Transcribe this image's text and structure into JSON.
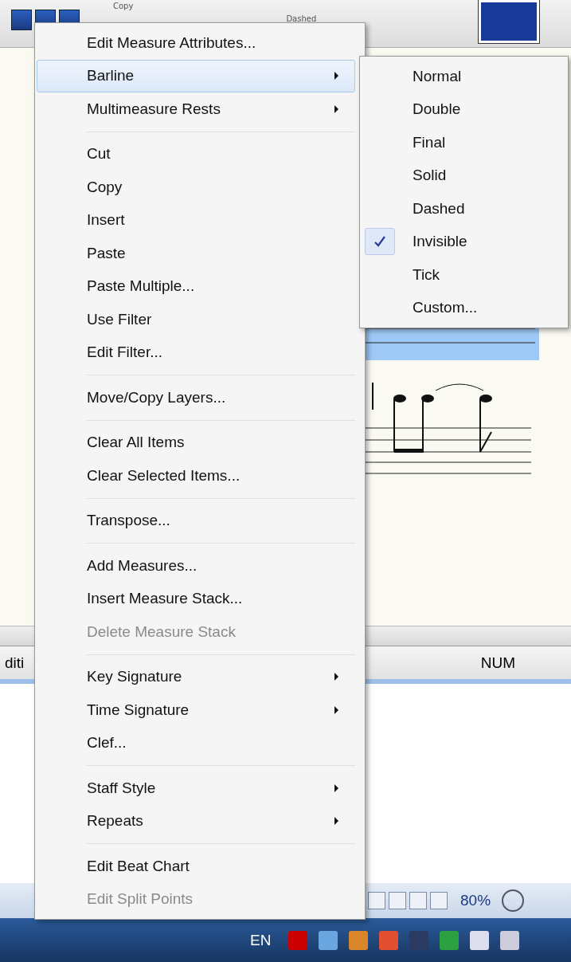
{
  "toolbar": {
    "labels": [
      "Copy",
      "Dashed"
    ]
  },
  "status_bar": {
    "mode_text": "diti",
    "indicator": "NUM"
  },
  "view_bar": {
    "zoom": "80%"
  },
  "taskbar": {
    "language": "EN"
  },
  "context_menu": {
    "groups": [
      [
        {
          "label": "Edit Measure Attributes...",
          "submenu": false,
          "disabled": false,
          "selected": false
        },
        {
          "label": "Barline",
          "submenu": true,
          "disabled": false,
          "selected": true
        },
        {
          "label": "Multimeasure Rests",
          "submenu": true,
          "disabled": false,
          "selected": false
        }
      ],
      [
        {
          "label": "Cut",
          "submenu": false,
          "disabled": false,
          "selected": false
        },
        {
          "label": "Copy",
          "submenu": false,
          "disabled": false,
          "selected": false
        },
        {
          "label": "Insert",
          "submenu": false,
          "disabled": false,
          "selected": false
        },
        {
          "label": "Paste",
          "submenu": false,
          "disabled": false,
          "selected": false
        },
        {
          "label": "Paste Multiple...",
          "submenu": false,
          "disabled": false,
          "selected": false
        },
        {
          "label": "Use Filter",
          "submenu": false,
          "disabled": false,
          "selected": false
        },
        {
          "label": "Edit Filter...",
          "submenu": false,
          "disabled": false,
          "selected": false
        }
      ],
      [
        {
          "label": "Move/Copy Layers...",
          "submenu": false,
          "disabled": false,
          "selected": false
        }
      ],
      [
        {
          "label": "Clear All Items",
          "submenu": false,
          "disabled": false,
          "selected": false
        },
        {
          "label": "Clear Selected Items...",
          "submenu": false,
          "disabled": false,
          "selected": false
        }
      ],
      [
        {
          "label": "Transpose...",
          "submenu": false,
          "disabled": false,
          "selected": false
        }
      ],
      [
        {
          "label": "Add Measures...",
          "submenu": false,
          "disabled": false,
          "selected": false
        },
        {
          "label": "Insert Measure Stack...",
          "submenu": false,
          "disabled": false,
          "selected": false
        },
        {
          "label": "Delete Measure Stack",
          "submenu": false,
          "disabled": true,
          "selected": false
        }
      ],
      [
        {
          "label": "Key Signature",
          "submenu": true,
          "disabled": false,
          "selected": false
        },
        {
          "label": "Time Signature",
          "submenu": true,
          "disabled": false,
          "selected": false
        },
        {
          "label": "Clef...",
          "submenu": false,
          "disabled": false,
          "selected": false
        }
      ],
      [
        {
          "label": "Staff Style",
          "submenu": true,
          "disabled": false,
          "selected": false
        },
        {
          "label": "Repeats",
          "submenu": true,
          "disabled": false,
          "selected": false
        }
      ],
      [
        {
          "label": "Edit Beat Chart",
          "submenu": false,
          "disabled": false,
          "selected": false
        },
        {
          "label": "Edit Split Points",
          "submenu": false,
          "disabled": true,
          "selected": false
        }
      ]
    ]
  },
  "submenu": {
    "items": [
      {
        "label": "Normal",
        "checked": false
      },
      {
        "label": "Double",
        "checked": false
      },
      {
        "label": "Final",
        "checked": false
      },
      {
        "label": "Solid",
        "checked": false
      },
      {
        "label": "Dashed",
        "checked": false
      },
      {
        "label": "Invisible",
        "checked": true
      },
      {
        "label": "Tick",
        "checked": false
      },
      {
        "label": "Custom...",
        "checked": false
      }
    ]
  }
}
